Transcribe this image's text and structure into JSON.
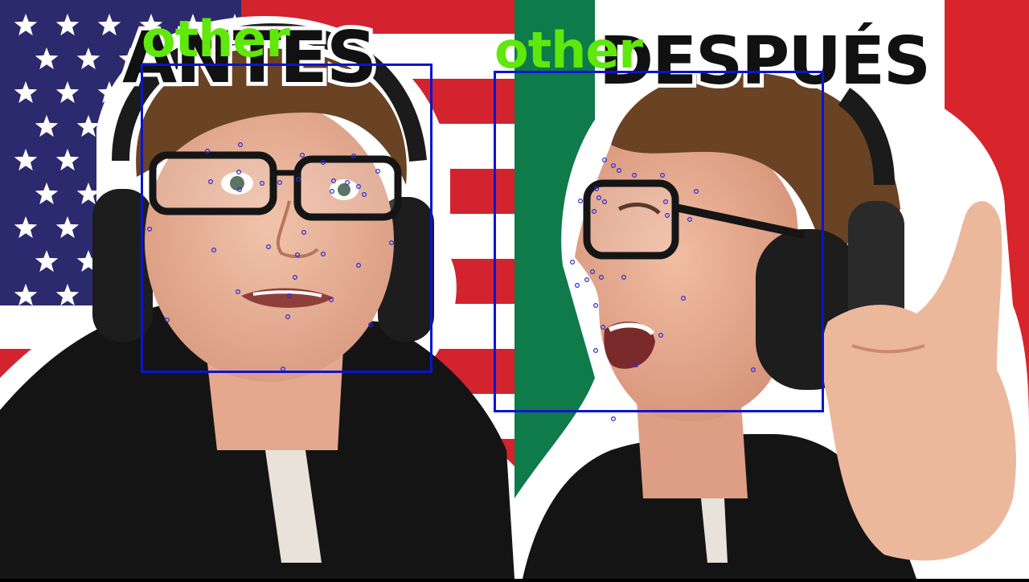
{
  "panels": {
    "left": {
      "title": "ANTES",
      "flag": "usa"
    },
    "right": {
      "title": "DESPUÉS",
      "flag": "mexico"
    }
  },
  "detections": [
    {
      "label": "other",
      "box_color": "#0a14d2",
      "label_color": "#5fe80a"
    },
    {
      "label": "other",
      "box_color": "#0a14d2",
      "label_color": "#5fe80a"
    }
  ],
  "colors": {
    "usa_red": "#d2232e",
    "usa_blue": "#2c2a6e",
    "mexico_green": "#0f7a4a",
    "mexico_red": "#d8242b",
    "outline_white": "#ffffff",
    "hoodie": "#151414",
    "skin": "#e9b39a",
    "hair": "#6a4224",
    "landmark": "#2a2ad8"
  }
}
